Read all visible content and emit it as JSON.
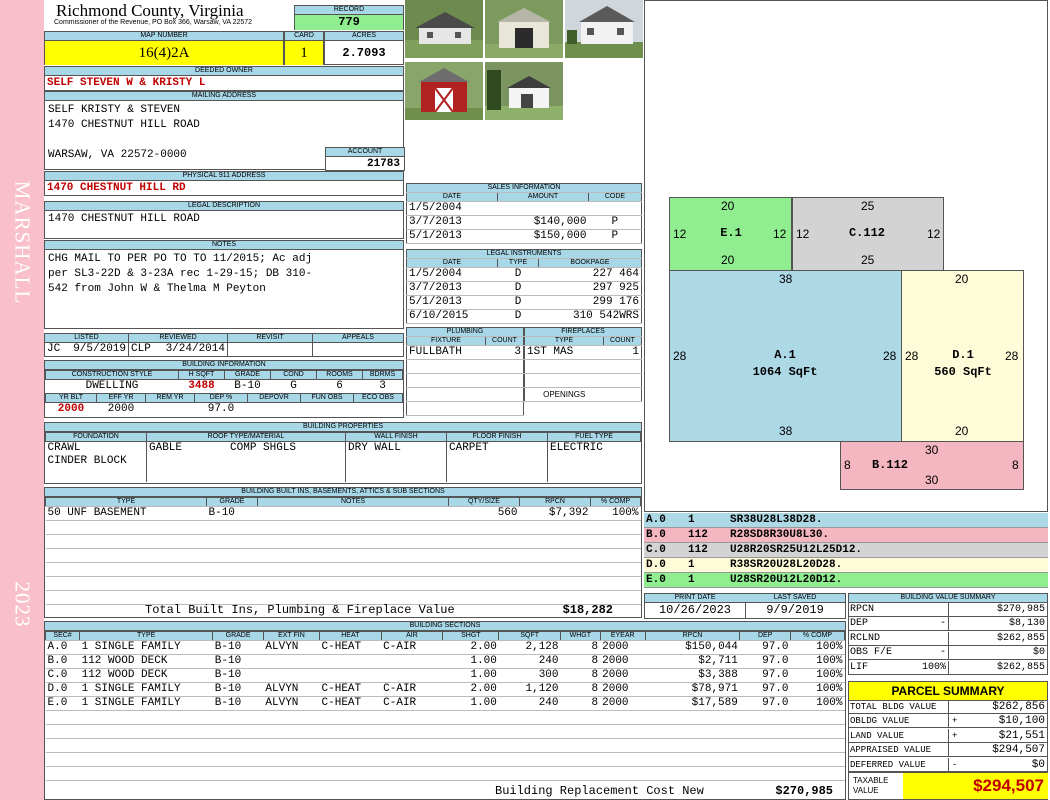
{
  "sidebar": {
    "district": "MARSHALL",
    "year": "2023"
  },
  "header": {
    "county": "Richmond County, Virginia",
    "commissioner": "Commissioner of the Revenue, PO Box 366, Warsaw, VA 22572",
    "record_label": "RECORD",
    "record": "779",
    "map_number_label": "MAP NUMBER",
    "map_number": "16(4)2A",
    "card_label": "CARD",
    "card": "1",
    "acres_label": "ACRES",
    "acres": "2.7093"
  },
  "owner": {
    "deeded_label": "DEEDED OWNER",
    "deeded": "SELF STEVEN W & KRISTY L",
    "mailing_label": "MAILING ADDRESS",
    "mailing": [
      "SELF KRISTY & STEVEN",
      "1470 CHESTNUT HILL ROAD",
      "",
      "WARSAW, VA 22572-0000"
    ],
    "account_label": "ACCOUNT",
    "account": "21783",
    "physical_label": "PHYSICAL 911 ADDRESS",
    "physical": "1470 CHESTNUT HILL RD",
    "legal_label": "LEGAL DESCRIPTION",
    "legal": "1470 CHESTNUT HILL ROAD",
    "notes_label": "NOTES",
    "notes": [
      "CHG MAIL TO PER PO TO TO 11/2015; Ac adj",
      "per SL3-22D & 3-23A rec 1-29-15; DB 310-",
      "542 from John W & Thelma M Peyton"
    ]
  },
  "review": {
    "headers": [
      "LISTED",
      "REVIEWED",
      "REVISIT",
      "APPEALS"
    ],
    "listed_by": "JC",
    "listed_date": "9/5/2019",
    "reviewed_by": "CLP",
    "reviewed_date": "3/24/2014"
  },
  "building_info": {
    "title": "BUILDING INFORMATION",
    "headers1": [
      "CONSTRUCTION STYLE",
      "H SQFT",
      "GRADE",
      "COND",
      "ROOMS",
      "BDRMS"
    ],
    "values1": [
      "DWELLING",
      "3488",
      "B-10",
      "G",
      "6",
      "3"
    ],
    "headers2": [
      "YR BLT",
      "EFF YR",
      "REM YR",
      "DEP %",
      "DEPOVR",
      "FUN OBS",
      "ECO OBS"
    ],
    "values2": [
      "2000",
      "2000",
      "",
      "97.0",
      "",
      "",
      ""
    ]
  },
  "sales": {
    "title": "SALES INFORMATION",
    "headers": [
      "DATE",
      "AMOUNT",
      "CODE"
    ],
    "rows": [
      [
        "1/5/2004",
        "",
        ""
      ],
      [
        "3/7/2013",
        "$140,000",
        "P"
      ],
      [
        "5/1/2013",
        "$150,000",
        "P"
      ]
    ]
  },
  "legal_instruments": {
    "title": "LEGAL INSTRUMENTS",
    "headers": [
      "DATE",
      "TYPE",
      "BOOKPAGE"
    ],
    "rows": [
      [
        "1/5/2004",
        "D",
        "227 464"
      ],
      [
        "3/7/2013",
        "D",
        "297 925"
      ],
      [
        "5/1/2013",
        "D",
        "299 176"
      ],
      [
        "6/10/2015",
        "D",
        "310 542WRS"
      ]
    ]
  },
  "plumbing": {
    "title": "PLUMBING",
    "headers": [
      "FIXTURE",
      "COUNT"
    ],
    "rows": [
      [
        "FULLBATH",
        "3"
      ]
    ]
  },
  "fireplaces": {
    "title": "FIREPLACES",
    "headers": [
      "TYPE",
      "COUNT"
    ],
    "rows": [
      [
        "1ST MAS",
        "1"
      ]
    ],
    "openings_label": "OPENINGS"
  },
  "properties": {
    "title": "BUILDING PROPERTIES",
    "headers": [
      "FOUNDATION",
      "ROOF TYPE/MATERIAL",
      "WALL FINISH",
      "FLOOR FINISH",
      "FUEL TYPE"
    ],
    "foundation": [
      "CRAWL",
      "CINDER BLOCK"
    ],
    "roof_type": "GABLE",
    "roof_material": "COMP SHGLS",
    "wall": "DRY WALL",
    "floor": "CARPET",
    "fuel": "ELECTRIC"
  },
  "builtins": {
    "title": "BUILDING BUILT INS, BASEMENTS, ATTICS & SUB SECTIONS",
    "headers": [
      "TYPE",
      "GRADE",
      "NOTES",
      "QTY/SIZE",
      "RPCN",
      "% COMP"
    ],
    "rows": [
      [
        "50 UNF BASEMENT",
        "B-10",
        "",
        "560",
        "$7,392",
        "100%"
      ]
    ],
    "total_label": "Total Built Ins, Plumbing & Fireplace Value",
    "total": "$18,282"
  },
  "dates": {
    "print_label": "PRINT DATE",
    "print": "10/26/2023",
    "saved_label": "LAST SAVED",
    "saved": "9/9/2019"
  },
  "sections": {
    "title": "BUILDING SECTIONS",
    "headers": [
      "SEC#",
      "TYPE",
      "GRADE",
      "EXT FIN",
      "HEAT",
      "AIR",
      "SHGT",
      "SQFT",
      "WHGT",
      "EYEAR",
      "RPCN",
      "DEP",
      "% COMP"
    ],
    "rows": [
      [
        "A.0",
        "1 SINGLE FAMILY",
        "B-10",
        "ALVYN",
        "C-HEAT",
        "C-AIR",
        "2.00",
        "2,128",
        "8",
        "2000",
        "$150,044",
        "97.0",
        "100%"
      ],
      [
        "B.0",
        "112 WOOD DECK",
        "B-10",
        "",
        "",
        "",
        "1.00",
        "240",
        "8",
        "2000",
        "$2,711",
        "97.0",
        "100%"
      ],
      [
        "C.0",
        "112 WOOD DECK",
        "B-10",
        "",
        "",
        "",
        "1.00",
        "300",
        "8",
        "2000",
        "$3,388",
        "97.0",
        "100%"
      ],
      [
        "D.0",
        "1 SINGLE FAMILY",
        "B-10",
        "ALVYN",
        "C-HEAT",
        "C-AIR",
        "2.00",
        "1,120",
        "8",
        "2000",
        "$78,971",
        "97.0",
        "100%"
      ],
      [
        "E.0",
        "1 SINGLE FAMILY",
        "B-10",
        "ALVYN",
        "C-HEAT",
        "C-AIR",
        "1.00",
        "240",
        "8",
        "2000",
        "$17,589",
        "97.0",
        "100%"
      ]
    ],
    "total_label": "Building Replacement Cost New",
    "total": "$270,985"
  },
  "sketch": {
    "legend": [
      {
        "sec": "A.0",
        "code": "1",
        "vectors": "SR38U28L38D28.",
        "color": "#add8e6"
      },
      {
        "sec": "B.0",
        "code": "112",
        "vectors": "R28SD8R30U8L30.",
        "color": "#f4b6c0"
      },
      {
        "sec": "C.0",
        "code": "112",
        "vectors": "U28R20SR25U12L25D12.",
        "color": "#d3d3d3"
      },
      {
        "sec": "D.0",
        "code": "1",
        "vectors": "R38SR20U28L20D28.",
        "color": "#fdfbd8"
      },
      {
        "sec": "E.0",
        "code": "1",
        "vectors": "U28SR20U12L20D12.",
        "color": "#90ee90"
      }
    ],
    "areas": {
      "A": {
        "label": "A.1",
        "area": "1064 SqFt",
        "top": "38",
        "bottom": "38",
        "left": "28",
        "right": "28"
      },
      "D": {
        "label": "D.1",
        "area": "560 SqFt",
        "top": "20",
        "bottom": "20",
        "left": "28",
        "right": "28"
      },
      "E": {
        "label": "E.1",
        "top": "20",
        "bottom": "20",
        "left": "12",
        "right": "12"
      },
      "C": {
        "label": "C.112",
        "top": "25",
        "bottom": "25",
        "left": "12",
        "right": "12"
      },
      "B": {
        "label": "B.112",
        "top": "30",
        "bottom": "30",
        "left": "8",
        "right": "8"
      }
    }
  },
  "value_summary": {
    "title": "BUILDING VALUE SUMMARY",
    "rows": [
      {
        "label": "RPCN",
        "sign": "",
        "value": "$270,985"
      },
      {
        "label": "DEP",
        "sign": "-",
        "value": "$8,130"
      },
      {
        "label": "RCLND",
        "sign": "",
        "value": "$262,855"
      },
      {
        "label": "OBS F/E",
        "sign": "-",
        "value": "$0"
      },
      {
        "label": "LIF",
        "sign": "100%",
        "value": "$262,855"
      }
    ]
  },
  "parcel_summary": {
    "title": "PARCEL SUMMARY",
    "rows": [
      {
        "label": "TOTAL BLDG VALUE",
        "sign": "",
        "value": "$262,856"
      },
      {
        "label": "OBLDG VALUE",
        "sign": "+",
        "value": "$10,100"
      },
      {
        "label": "LAND VALUE",
        "sign": "+",
        "value": "$21,551"
      },
      {
        "label": "APPRAISED VALUE",
        "sign": "",
        "value": "$294,507"
      },
      {
        "label": "DEFERRED VALUE",
        "sign": "-",
        "value": "$0"
      }
    ],
    "taxable_label": "TAXABLE VALUE",
    "taxable": "$294,507"
  }
}
